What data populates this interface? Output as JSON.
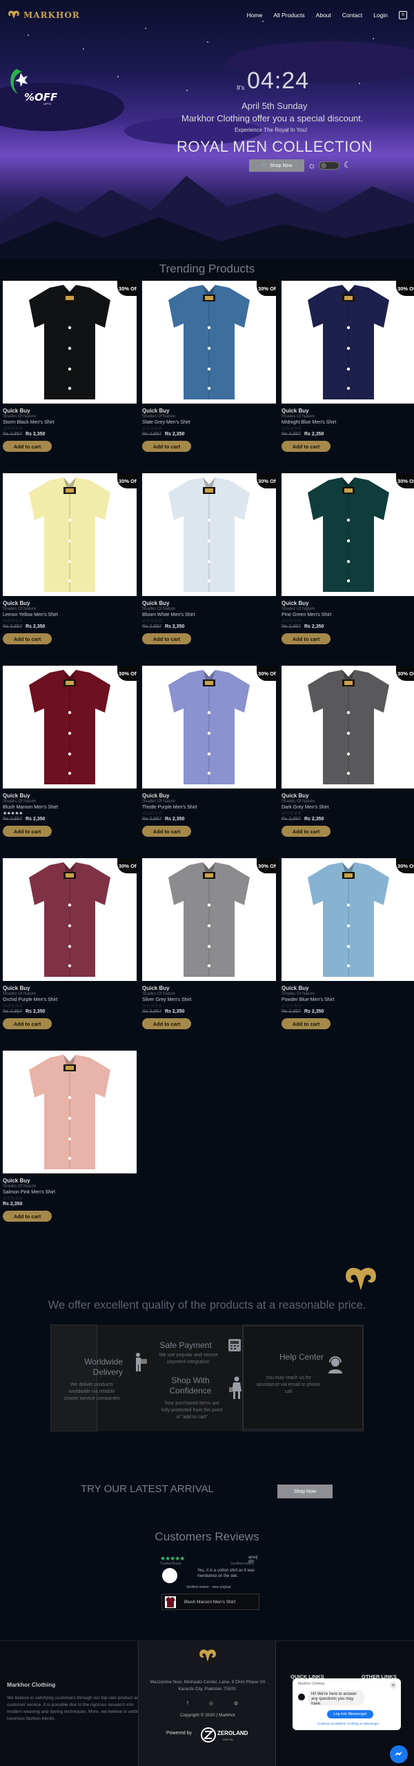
{
  "nav": {
    "brand": "MARKHOR",
    "links": [
      "Home",
      "All Products",
      "About",
      "Contact",
      "Login"
    ],
    "cart_count": "0"
  },
  "hero": {
    "sale": "%OFF",
    "sale_sub": "UPTO",
    "its": "It's",
    "time": "04:24",
    "date": "April 5th Sunday",
    "offer": "Markhor Clothing offer you a special discount.",
    "tagline": "Experience The Royal In You!",
    "title": "ROYAL MEN COLLECTION",
    "shop_now": "Shop Now"
  },
  "trending_title": "Trending Products",
  "products": [
    {
      "quick": "Quick Buy",
      "brand": "Shades Of Nature",
      "name": "Storm Black Men's Shirt",
      "old": "Rs 2,857",
      "new": "Rs 2,350",
      "badge": "30% Off",
      "color": "#111214",
      "rated": false
    },
    {
      "quick": "Quick Buy",
      "brand": "Shades Of Nature",
      "name": "Slate Grey Men's Shirt",
      "old": "Rs 2,857",
      "new": "Rs 2,350",
      "badge": "30% Off",
      "color": "#3c6e9e",
      "rated": false
    },
    {
      "quick": "Quick Buy",
      "brand": "Shades Of Nature",
      "name": "Midnight Blue Men's Shirt",
      "old": "Rs 2,857",
      "new": "Rs 2,350",
      "badge": "30% Off",
      "color": "#1d1f4c",
      "rated": false
    },
    {
      "quick": "Quick Buy",
      "brand": "Shades Of Nature",
      "name": "Lemon Yellow Men's Shirt",
      "old": "Rs 2,857",
      "new": "Rs 2,350",
      "badge": "30% Off",
      "color": "#f1ecaa",
      "rated": false
    },
    {
      "quick": "Quick Buy",
      "brand": "Shades Of Nature",
      "name": "Bloom White Men's Shirt",
      "old": "Rs 2,857",
      "new": "Rs 2,350",
      "badge": "30% Off",
      "color": "#dde6ee",
      "rated": false
    },
    {
      "quick": "Quick Buy",
      "brand": "Shades Of Nature",
      "name": "Pine Green Men's Shirt",
      "old": "Rs 2,857",
      "new": "Rs 2,350",
      "badge": "30% Off",
      "color": "#0f3d3b",
      "rated": false
    },
    {
      "quick": "Quick Buy",
      "brand": "Shades Of Nature",
      "name": "Blush Maroon Men's Shirt",
      "old": "Rs 2,857",
      "new": "Rs 2,350",
      "badge": "30% Off",
      "color": "#6d1020",
      "rated": true
    },
    {
      "quick": "Quick Buy",
      "brand": "Shades Of Nature",
      "name": "Thistle Purple Men's Shirt",
      "old": "Rs 2,857",
      "new": "Rs 2,350",
      "badge": "30% Off",
      "color": "#8a92cf",
      "rated": false
    },
    {
      "quick": "Quick Buy",
      "brand": "Shades Of Nature",
      "name": "Dark Grey Men's Shirt",
      "old": "Rs 2,857",
      "new": "Rs 2,350",
      "badge": "30% Off",
      "color": "#59595b",
      "rated": false
    },
    {
      "quick": "Quick Buy",
      "brand": "Shades Of Nature",
      "name": "Orchid Purple Men's Shirt",
      "old": "Rs 2,857",
      "new": "Rs 2,350",
      "badge": "30% Off",
      "color": "#7f3246",
      "rated": false
    },
    {
      "quick": "Quick Buy",
      "brand": "Shades Of Nature",
      "name": "Silver Grey Men's Shirt",
      "old": "Rs 2,857",
      "new": "Rs 2,350",
      "badge": "30% Off",
      "color": "#8c8c8e",
      "rated": false
    },
    {
      "quick": "Quick Buy",
      "brand": "Shades Of Nature",
      "name": "Powder Blue Men's Shirt",
      "old": "Rs 2,857",
      "new": "Rs 2,350",
      "badge": "30% Off",
      "color": "#87b3d2",
      "rated": false
    },
    {
      "quick": "Quick Buy",
      "brand": "Shades Of Nature",
      "name": "Salmon Pink Men's Shirt",
      "old": "",
      "new": "Rs 2,350",
      "badge": "",
      "color": "#e8b3a8",
      "rated": false
    }
  ],
  "add_to_cart": "Add to cart",
  "quality": "We offer excellent quality of the products at a reasonable price.",
  "features": {
    "worldwide_title": "Worldwide Delivery",
    "worldwide_desc": "We deliver products worldwide via reliable courier service companies",
    "safe_title": "Safe Payment",
    "safe_desc": "We use popular and secure payment integration",
    "shop_title": "Shop With Confidence",
    "shop_desc": "Your purchased items are fully protected from the point of \"add to cart\"",
    "help_title": "Help Center",
    "help_desc": "You may reach us for assistance via email or phone call"
  },
  "try": {
    "label": "TRY OUR LATEST ARRIVAL",
    "button": "Shop Now"
  },
  "reviews": {
    "title": "Customers Reviews",
    "stars": "★★★★★",
    "name": "arooj din",
    "sub": "Trusted Buyer",
    "verif": "(verified owner)",
    "text": "Yes, it is a cotton shirt as it was mentioned on the site.",
    "verified": "Verified review - view original",
    "product": "Blush Maroon Men's Shirt"
  },
  "footer": {
    "brand": "Markhor Clothing",
    "about": "We believe in satisfying customers through our top-rate product and customer service. It is possible due to the rigorous research into modern weaving and dyeing techniques. More, we believe in setting luxurious fashion trends.",
    "address": "Mezzanine floor, Minhaalo Center, Lane, 9 DHA Phase VII Karachi City, Pakistan 75500.",
    "social": "f ◎ ◍",
    "copyright": "Copyright © 2020 | Markhor",
    "powered": "Powered by",
    "zero": "ZEROLAND",
    "zero_sub": "DIGITAL",
    "quick_links": "QUICK LINKS",
    "other_links": "OTHER LINKS"
  },
  "chat": {
    "head": "Markhor Clothing",
    "msg": "Hi! We're here to answer any questions you may have.",
    "login": "Log into Messenger",
    "cont": "Continue as Markhor Clothing on Messenger"
  }
}
